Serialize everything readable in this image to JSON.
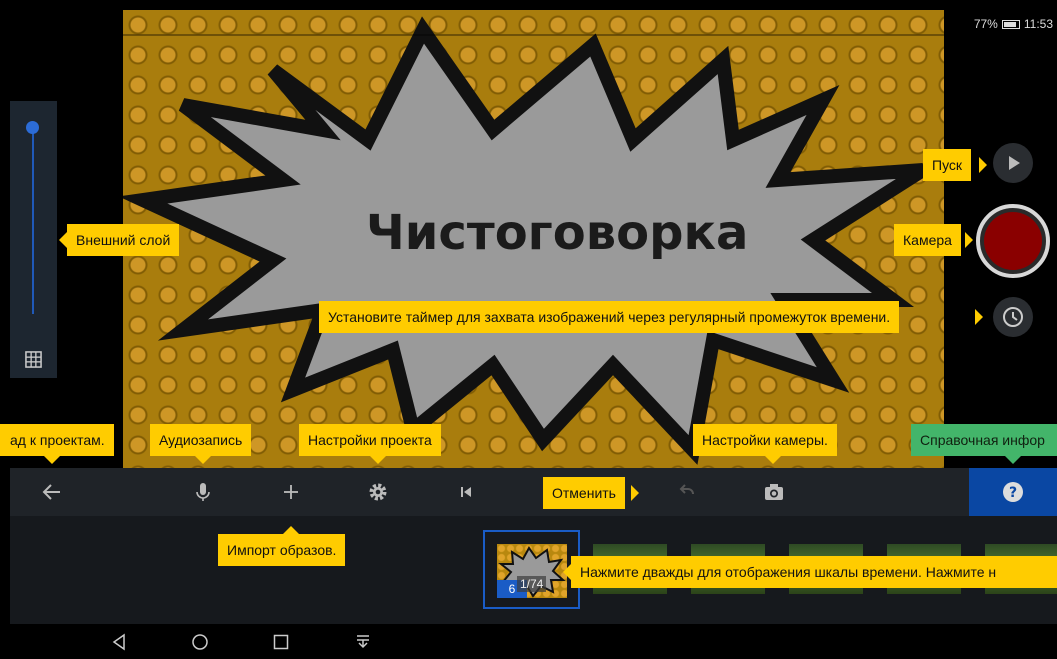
{
  "status_bar": {
    "battery": "77%",
    "time": "11:53"
  },
  "preview": {
    "title_text": "Чистоговорка"
  },
  "filmstrip": {
    "frame_counter": "1/74",
    "frame_number": "6"
  },
  "tooltips": {
    "play": "Пуск",
    "camera": "Камера",
    "outer_layer": "Внешний слой",
    "timer": "Установите таймер для захвата изображений через регулярный промежуток времени.",
    "back": "ад к проектам.",
    "audio": "Аудиозапись",
    "project_settings": "Настройки проекта",
    "camera_settings": "Настройки камеры.",
    "help": "Справочная инфор",
    "undo": "Отменить",
    "import": "Импорт образов.",
    "timeline": "Нажмите дважды для отображения шкалы времени. Нажмите н"
  },
  "colors": {
    "tooltip": "#ffcc00",
    "tooltip_help": "#43b56a",
    "accent_blue": "#0a47a3",
    "record_red": "#8a0000",
    "toolbar_bg": "#1f2328"
  },
  "icons": {
    "back": "arrow-left-icon",
    "audio": "microphone-icon",
    "import": "plus-icon",
    "settings": "gear-icon",
    "skip_start": "skip-to-start-icon",
    "undo": "undo-icon",
    "camera_settings": "camera-icon",
    "help": "help-icon",
    "play": "play-icon",
    "timer": "clock-icon",
    "grid": "grid-icon"
  }
}
